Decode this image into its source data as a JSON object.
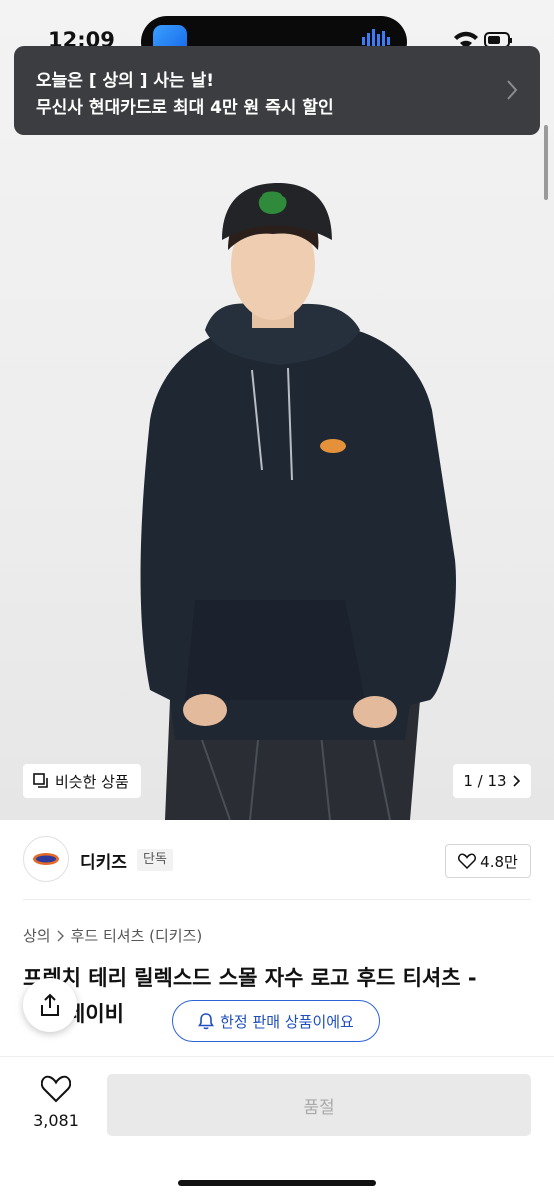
{
  "status_bar": {
    "time": "12:09"
  },
  "notification": {
    "line1": "오늘은 [ 상의 ] 사는 날!",
    "line2": "무신사 현대카드로 최대 4만 원 즉시 할인"
  },
  "gallery": {
    "similar_label": "비슷한 상품",
    "pager": "1 / 13"
  },
  "brand": {
    "name": "디키즈",
    "badge": "단독",
    "likes": "4.8만"
  },
  "breadcrumb": {
    "category": "상의",
    "subcategory": "후드 티셔츠 (디키즈)"
  },
  "product": {
    "title_line1": "프렌치 테리 릴렉스드 스몰 자수 로고 후드 티셔츠 -",
    "title_line2": "네이비"
  },
  "limited_notice": "한정 판매 상품이에요",
  "bottom": {
    "wish_count": "3,081",
    "cta_label": "품절"
  },
  "colors": {
    "banner_bg": "#3b3d40",
    "accent_blue": "#2d63d6",
    "soldout_bg": "#e9e9e9",
    "hoodie": "#1f2733"
  }
}
